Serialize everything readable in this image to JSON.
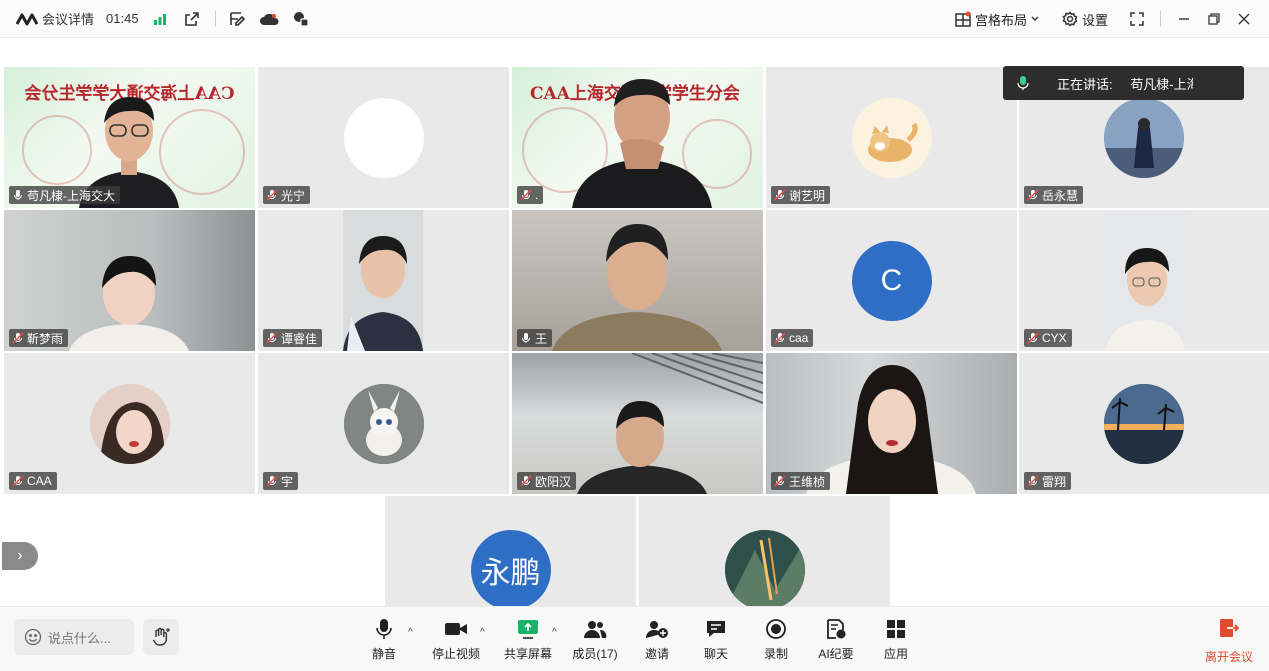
{
  "topbar": {
    "title": "会议详情",
    "time": "01:45",
    "layout_label": "宫格布局",
    "settings_label": "设置"
  },
  "speaking": {
    "prefix": "正在讲话:",
    "name": "苟凡棣-上海交大"
  },
  "banner": {
    "text_left": "CAA上海交通大学学生分会",
    "text_right": "CAA上海交通大学学生分会"
  },
  "participants": [
    {
      "name": "苟凡棣-上海交大",
      "mic": "on"
    },
    {
      "name": "光宁",
      "mic": "muted"
    },
    {
      "name": ".",
      "mic": "muted"
    },
    {
      "name": "谢艺明",
      "mic": "muted"
    },
    {
      "name": "岳永慧",
      "mic": "muted"
    },
    {
      "name": "靳梦雨",
      "mic": "muted"
    },
    {
      "name": "谭睿佳",
      "mic": "muted"
    },
    {
      "name": "王",
      "mic": "on"
    },
    {
      "name": "caa",
      "mic": "muted",
      "avatar_letter": "C"
    },
    {
      "name": "CYX",
      "mic": "muted"
    },
    {
      "name": "CAA",
      "mic": "muted"
    },
    {
      "name": "宇",
      "mic": "muted"
    },
    {
      "name": "欧阳汉",
      "mic": "muted"
    },
    {
      "name": "王维桢",
      "mic": "muted"
    },
    {
      "name": "雷翔",
      "mic": "muted"
    },
    {
      "name": "",
      "mic": "none",
      "avatar_text": "永鹏"
    },
    {
      "name": "",
      "mic": "none"
    }
  ],
  "bottombar": {
    "chat_placeholder": "说点什么...",
    "mute_label": "静音",
    "video_label": "停止视频",
    "share_label": "共享屏幕",
    "members_label": "成员(17)",
    "invite_label": "邀请",
    "chat_label": "聊天",
    "record_label": "录制",
    "ai_label": "AI纪要",
    "apps_label": "应用",
    "leave_label": "离开会议"
  },
  "colors": {
    "active_border": "#3fce8a",
    "accent_blue": "#2e6ec4",
    "leave_red": "#e04a2f",
    "share_green": "#1bb36b"
  }
}
